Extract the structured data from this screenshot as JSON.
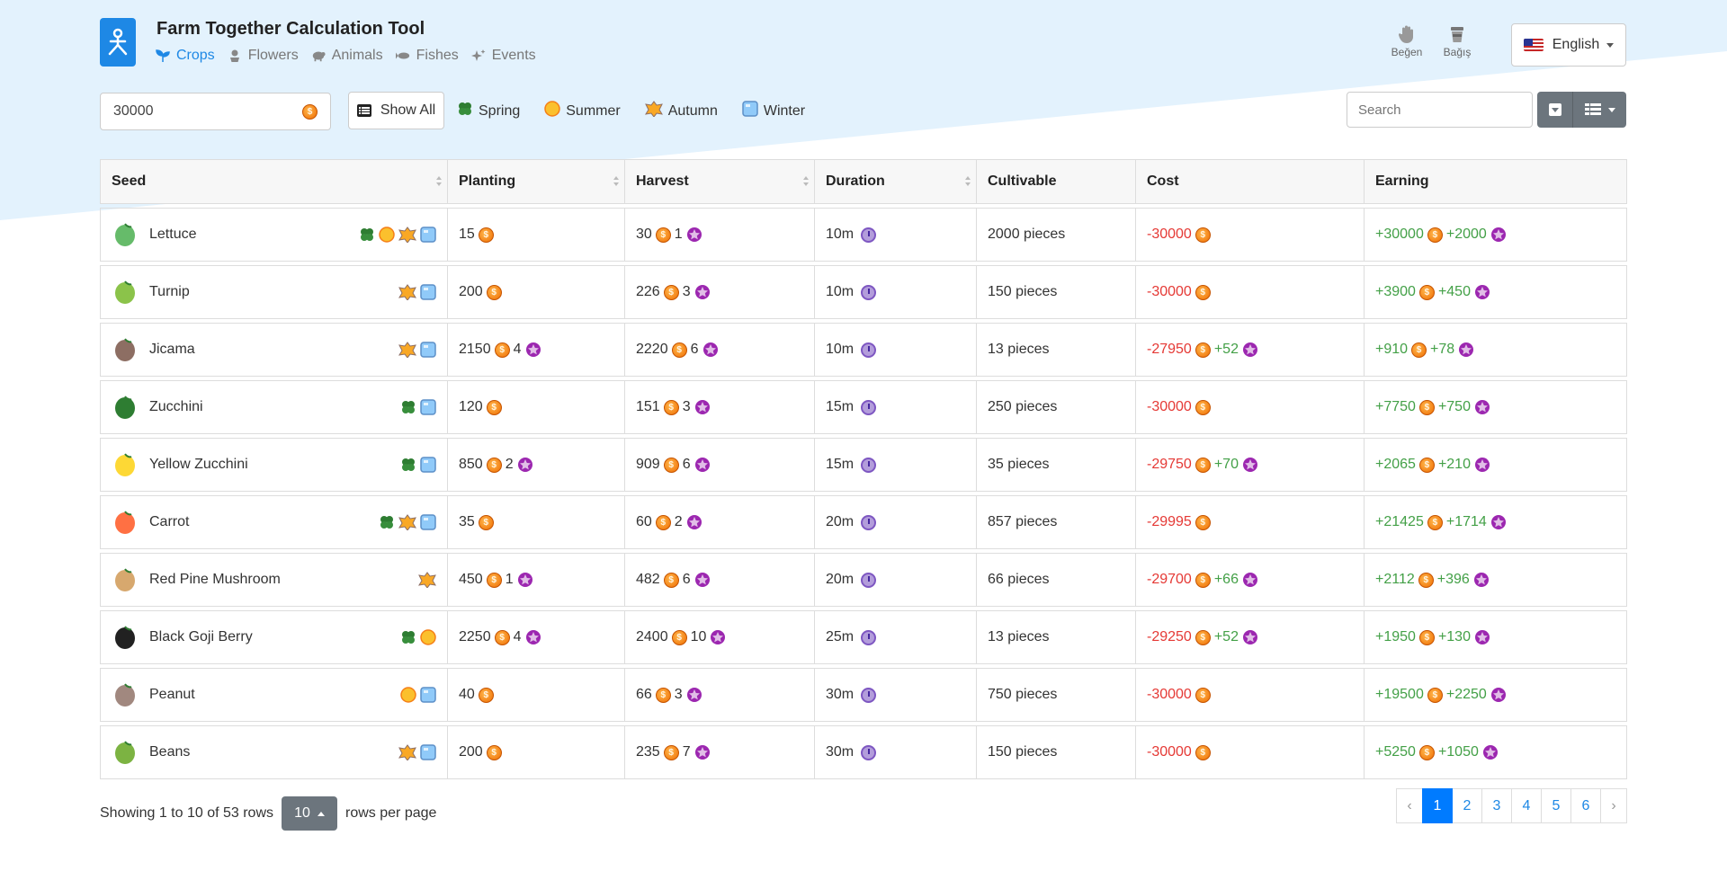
{
  "app": {
    "title": "Farm Together Calculation Tool"
  },
  "nav": [
    {
      "label": "Crops",
      "icon": "sprout-icon",
      "active": true
    },
    {
      "label": "Flowers",
      "icon": "flower-icon",
      "active": false
    },
    {
      "label": "Animals",
      "icon": "sheep-icon",
      "active": false
    },
    {
      "label": "Fishes",
      "icon": "fish-icon",
      "active": false
    },
    {
      "label": "Events",
      "icon": "sparkle-icon",
      "active": false
    }
  ],
  "header_actions": {
    "like_label": "Beğen",
    "donate_label": "Bağış"
  },
  "language": {
    "selected": "English"
  },
  "toolbar": {
    "amount_value": "30000",
    "show_all_label": "Show All",
    "seasons": [
      "Spring",
      "Summer",
      "Autumn",
      "Winter"
    ],
    "search_placeholder": "Search"
  },
  "table": {
    "headers": [
      "Seed",
      "Planting",
      "Harvest",
      "Duration",
      "Cultivable",
      "Cost",
      "Earning"
    ],
    "rows": [
      {
        "seed": "Lettuce",
        "seasons": [
          "spring",
          "summer",
          "autumn",
          "winter"
        ],
        "planting": "15",
        "planting_gems": "",
        "harvest": "30",
        "harvest_gems": "1",
        "duration": "10m",
        "cultivable": "2000 pieces",
        "cost": "-30000",
        "cost_gems": "",
        "earning": "+30000",
        "earning_gems": "+2000"
      },
      {
        "seed": "Turnip",
        "seasons": [
          "autumn",
          "winter"
        ],
        "planting": "200",
        "planting_gems": "",
        "harvest": "226",
        "harvest_gems": "3",
        "duration": "10m",
        "cultivable": "150 pieces",
        "cost": "-30000",
        "cost_gems": "",
        "earning": "+3900",
        "earning_gems": "+450"
      },
      {
        "seed": "Jicama",
        "seasons": [
          "autumn",
          "winter"
        ],
        "planting": "2150",
        "planting_gems": "4",
        "harvest": "2220",
        "harvest_gems": "6",
        "duration": "10m",
        "cultivable": "13 pieces",
        "cost": "-27950",
        "cost_gems": "+52",
        "earning": "+910",
        "earning_gems": "+78"
      },
      {
        "seed": "Zucchini",
        "seasons": [
          "spring",
          "winter"
        ],
        "planting": "120",
        "planting_gems": "",
        "harvest": "151",
        "harvest_gems": "3",
        "duration": "15m",
        "cultivable": "250 pieces",
        "cost": "-30000",
        "cost_gems": "",
        "earning": "+7750",
        "earning_gems": "+750"
      },
      {
        "seed": "Yellow Zucchini",
        "seasons": [
          "spring",
          "winter"
        ],
        "planting": "850",
        "planting_gems": "2",
        "harvest": "909",
        "harvest_gems": "6",
        "duration": "15m",
        "cultivable": "35 pieces",
        "cost": "-29750",
        "cost_gems": "+70",
        "earning": "+2065",
        "earning_gems": "+210"
      },
      {
        "seed": "Carrot",
        "seasons": [
          "spring",
          "autumn",
          "winter"
        ],
        "planting": "35",
        "planting_gems": "",
        "harvest": "60",
        "harvest_gems": "2",
        "duration": "20m",
        "cultivable": "857 pieces",
        "cost": "-29995",
        "cost_gems": "",
        "earning": "+21425",
        "earning_gems": "+1714"
      },
      {
        "seed": "Red Pine Mushroom",
        "seasons": [
          "autumn"
        ],
        "planting": "450",
        "planting_gems": "1",
        "harvest": "482",
        "harvest_gems": "6",
        "duration": "20m",
        "cultivable": "66 pieces",
        "cost": "-29700",
        "cost_gems": "+66",
        "earning": "+2112",
        "earning_gems": "+396"
      },
      {
        "seed": "Black Goji Berry",
        "seasons": [
          "spring",
          "summer"
        ],
        "planting": "2250",
        "planting_gems": "4",
        "harvest": "2400",
        "harvest_gems": "10",
        "duration": "25m",
        "cultivable": "13 pieces",
        "cost": "-29250",
        "cost_gems": "+52",
        "earning": "+1950",
        "earning_gems": "+130"
      },
      {
        "seed": "Peanut",
        "seasons": [
          "summer",
          "winter"
        ],
        "planting": "40",
        "planting_gems": "",
        "harvest": "66",
        "harvest_gems": "3",
        "duration": "30m",
        "cultivable": "750 pieces",
        "cost": "-30000",
        "cost_gems": "",
        "earning": "+19500",
        "earning_gems": "+2250"
      },
      {
        "seed": "Beans",
        "seasons": [
          "autumn",
          "winter"
        ],
        "planting": "200",
        "planting_gems": "",
        "harvest": "235",
        "harvest_gems": "7",
        "duration": "30m",
        "cultivable": "150 pieces",
        "cost": "-30000",
        "cost_gems": "",
        "earning": "+5250",
        "earning_gems": "+1050"
      }
    ]
  },
  "footer": {
    "showing_text": "Showing 1 to 10 of 53 rows",
    "page_size": "10",
    "rows_per_page_text": "rows per page",
    "pages": [
      "‹",
      "1",
      "2",
      "3",
      "4",
      "5",
      "6",
      "›"
    ],
    "active_page": "1"
  },
  "colors": {
    "accent": "#1e88e5",
    "negative": "#e53935",
    "positive": "#43a047",
    "button_gray": "#6c757d"
  }
}
